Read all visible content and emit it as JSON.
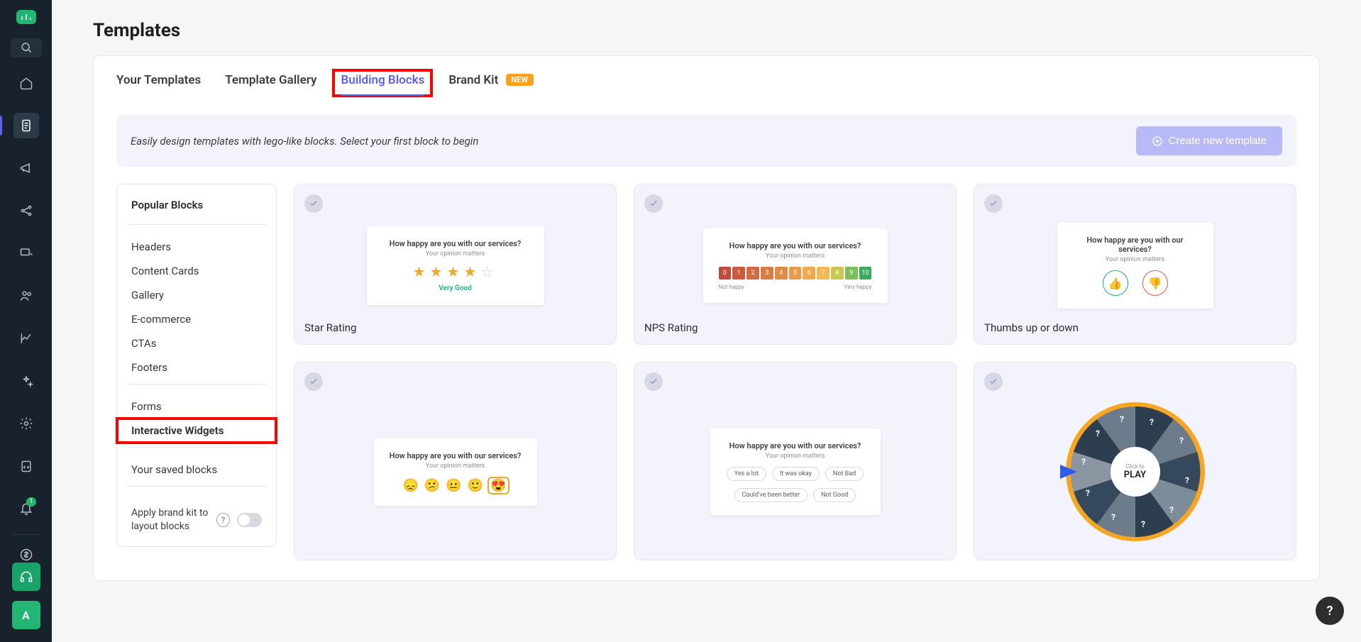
{
  "sidebar": {
    "avatar_letter": "A",
    "notification_badge": "1"
  },
  "page": {
    "title": "Templates"
  },
  "tabs": {
    "items": [
      {
        "label": "Your Templates"
      },
      {
        "label": "Template Gallery"
      },
      {
        "label": "Building Blocks",
        "active": true
      },
      {
        "label": "Brand Kit",
        "badge": "NEW"
      }
    ]
  },
  "banner": {
    "text": "Easily design templates with lego-like blocks. Select your first block to begin",
    "button": "Create new template"
  },
  "categories": {
    "heading": "Popular Blocks",
    "group1": [
      "Headers",
      "Content Cards",
      "Gallery",
      "E-commerce",
      "CTAs",
      "Footers"
    ],
    "group2": [
      "Forms",
      "Interactive Widgets"
    ],
    "saved": "Your saved blocks",
    "brand_kit_label": "Apply brand kit to layout blocks"
  },
  "blocks": {
    "survey_title": "How happy are you with our services?",
    "survey_sub": "Your opinion matters",
    "star_label": "Very Good",
    "nps": {
      "not_happy": "Not happy",
      "very_happy": "Very happy",
      "values": [
        "0",
        "1",
        "2",
        "3",
        "4",
        "5",
        "6",
        "7",
        "8",
        "9",
        "10"
      ]
    },
    "chips_row1": [
      "Yes a lot",
      "It was okay",
      "Not Bad"
    ],
    "chips_row2": [
      "Could've been better",
      "Not Good"
    ],
    "wheel": {
      "click": "Click to",
      "play": "PLAY"
    },
    "titles": {
      "star": "Star Rating",
      "nps": "NPS Rating",
      "thumbs": "Thumbs up or down"
    }
  }
}
